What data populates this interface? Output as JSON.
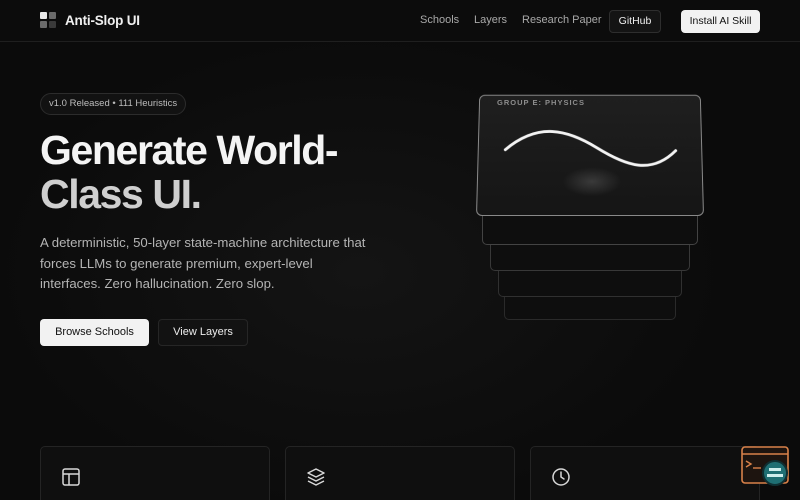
{
  "nav": {
    "brand": "Anti-Slop UI",
    "links": [
      "Schools",
      "Layers",
      "Research Paper"
    ],
    "github": "GitHub",
    "install": "Install AI Skill"
  },
  "hero": {
    "badge": "v1.0 Released • 111 Heuristics",
    "title_line1": "Generate World-",
    "title_line2": "Class UI.",
    "subtitle": "A deterministic, 50-layer state-machine architecture that forces LLMs to generate premium, expert-level interfaces. Zero hallucination. Zero slop.",
    "browse_button": "Browse Schools",
    "layers_button": "View Layers"
  },
  "visual": {
    "card_label": "GROUP E: PHYSICS"
  },
  "features": {
    "icons": [
      "layout-icon",
      "layers-icon",
      "clock-icon"
    ]
  },
  "colors": {
    "background": "#0b0b0b",
    "accent_button": "#f2f2f2",
    "widget_orange": "#d9824a",
    "widget_teal": "#1f6f73"
  }
}
